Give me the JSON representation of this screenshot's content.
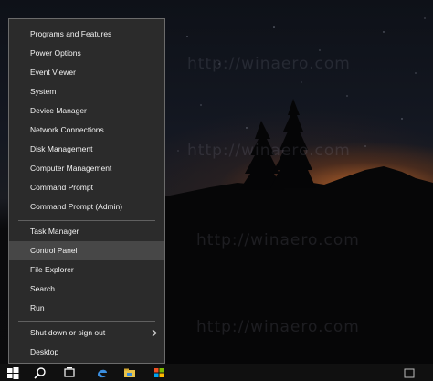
{
  "menu": {
    "items": [
      {
        "label": "Programs and Features"
      },
      {
        "label": "Power Options"
      },
      {
        "label": "Event Viewer"
      },
      {
        "label": "System"
      },
      {
        "label": "Device Manager"
      },
      {
        "label": "Network Connections"
      },
      {
        "label": "Disk Management"
      },
      {
        "label": "Computer Management"
      },
      {
        "label": "Command Prompt"
      },
      {
        "label": "Command Prompt (Admin)"
      },
      {
        "label": "Task Manager"
      },
      {
        "label": "Control Panel"
      },
      {
        "label": "File Explorer"
      },
      {
        "label": "Search"
      },
      {
        "label": "Run"
      },
      {
        "label": "Shut down or sign out"
      },
      {
        "label": "Desktop"
      }
    ]
  },
  "watermark": {
    "text": "http://winaero.com"
  },
  "taskbar": {
    "icons": [
      "start-icon",
      "search-icon",
      "task-view-icon",
      "file-explorer-icon",
      "edge-icon",
      "store-icon",
      "windows-icon"
    ]
  },
  "colors": {
    "menu_bg": "#2b2b2b",
    "menu_highlight": "#474747",
    "menu_border": "#6b6b6b",
    "menu_text": "#f2f2f2",
    "taskbar_bg": "#101010",
    "sky_glow": "#cd6e2d"
  }
}
